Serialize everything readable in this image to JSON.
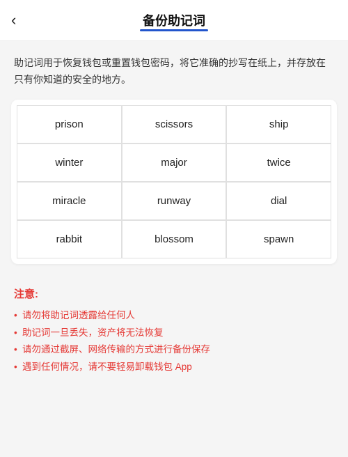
{
  "header": {
    "back_label": "‹",
    "title": "备份助记词"
  },
  "description": {
    "text": "助记词用于恢复钱包或重置钱包密码，将它准确的抄写在纸上，并存放在只有你知道的安全的地方。"
  },
  "mnemonic": {
    "words": [
      {
        "id": 1,
        "word": "prison"
      },
      {
        "id": 2,
        "word": "scissors"
      },
      {
        "id": 3,
        "word": "ship"
      },
      {
        "id": 4,
        "word": "winter"
      },
      {
        "id": 5,
        "word": "major"
      },
      {
        "id": 6,
        "word": "twice"
      },
      {
        "id": 7,
        "word": "miracle"
      },
      {
        "id": 8,
        "word": "runway"
      },
      {
        "id": 9,
        "word": "dial"
      },
      {
        "id": 10,
        "word": "rabbit"
      },
      {
        "id": 11,
        "word": "blossom"
      },
      {
        "id": 12,
        "word": "spawn"
      }
    ]
  },
  "notes": {
    "title": "注意:",
    "items": [
      "请勿将助记词透露给任何人",
      "助记词一旦丢失，资产将无法恢复",
      "请勿通过截屏、网络传输的方式进行备份保存",
      "遇到任何情况，请不要轻易卸载钱包 App"
    ]
  }
}
